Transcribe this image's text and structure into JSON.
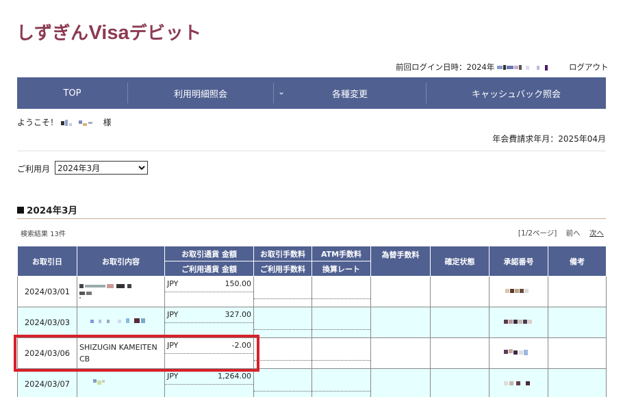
{
  "header": {
    "logo_jp": "しずぎん",
    "logo_en": "Visa",
    "logo_jp2": "デビット",
    "last_login_label": "前回ログイン日時：2024年",
    "logout_label": "ログアウト"
  },
  "nav": {
    "items": [
      {
        "label": "TOP"
      },
      {
        "label": "利用明細照会"
      },
      {
        "label": "各種変更"
      },
      {
        "label": "キャッシュバック照会"
      }
    ]
  },
  "welcome": {
    "prefix": "ようこそ！",
    "suffix": "様"
  },
  "fee_month": "年会費請求年月：2025年04月",
  "month_select": {
    "label": "ご利用月",
    "value": "2024年3月"
  },
  "section_title": "2024年3月",
  "results_label": "検索結果 13件",
  "pager": {
    "page": "[1/2ページ]",
    "prev": "前へ",
    "next": "次へ"
  },
  "table": {
    "headers": {
      "date": "お取引日",
      "desc": "お取引内容",
      "amount_top": "お取引通貨 金額",
      "amount_bottom": "ご利用通貨 金額",
      "fee_top": "お取引手数料",
      "fee_bottom": "ご利用手数料",
      "atm_top": "ATM手数料",
      "atm_bottom": "換算レート",
      "fx_fee": "為替手数料",
      "status": "確定状態",
      "approval": "承認番号",
      "note": "備考"
    },
    "rows": [
      {
        "date": "2024/03/01",
        "desc": "",
        "currency": "JPY",
        "amount": "150.00"
      },
      {
        "date": "2024/03/03",
        "desc": "",
        "currency": "JPY",
        "amount": "327.00"
      },
      {
        "date": "2024/03/06",
        "desc": "SHIZUGIN KAMEITEN CB",
        "currency": "JPY",
        "amount": "-2.00"
      },
      {
        "date": "2024/03/07",
        "desc": "",
        "currency": "JPY",
        "amount": "1,264.00"
      }
    ]
  },
  "colors": {
    "nav_bg": "#506091",
    "brand": "#8c3a52",
    "row_alt": "#e6ffff",
    "highlight": "#d8202a"
  }
}
